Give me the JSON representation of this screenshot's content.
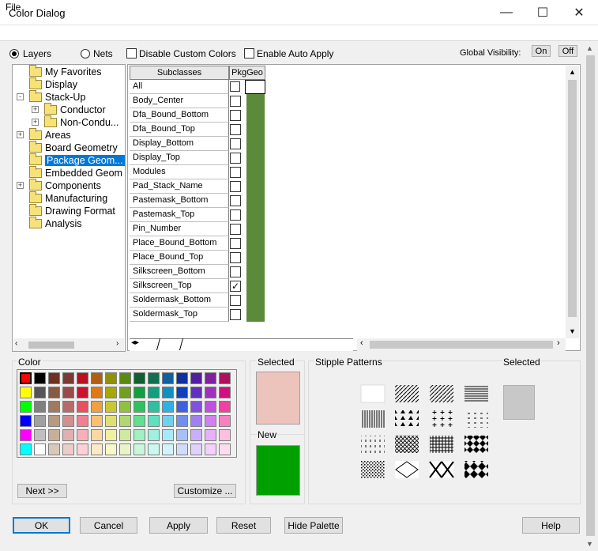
{
  "window": {
    "title": "Color Dialog",
    "minimize": "—",
    "maximize": "☐",
    "close": "✕"
  },
  "menu": {
    "file": "File"
  },
  "toolbar": {
    "layers": "Layers",
    "nets": "Nets",
    "disable_custom": "Disable Custom Colors",
    "enable_auto": "Enable Auto Apply",
    "global_visibility": "Global Visibility:",
    "on": "On",
    "off": "Off"
  },
  "tree": [
    {
      "label": "My Favorites",
      "indent": 0,
      "expander": ""
    },
    {
      "label": "Display",
      "indent": 0,
      "expander": ""
    },
    {
      "label": "Stack-Up",
      "indent": 0,
      "expander": "-"
    },
    {
      "label": "Conductor",
      "indent": 1,
      "expander": "+"
    },
    {
      "label": "Non-Condu...",
      "indent": 1,
      "expander": "+"
    },
    {
      "label": "Areas",
      "indent": 0,
      "expander": "+"
    },
    {
      "label": "Board Geometry",
      "indent": 0,
      "expander": ""
    },
    {
      "label": "Package Geom...",
      "indent": 0,
      "expander": "",
      "selected": true
    },
    {
      "label": "Embedded Geom",
      "indent": 0,
      "expander": ""
    },
    {
      "label": "Components",
      "indent": 0,
      "expander": "+"
    },
    {
      "label": "Manufacturing",
      "indent": 0,
      "expander": ""
    },
    {
      "label": "Drawing Format",
      "indent": 0,
      "expander": ""
    },
    {
      "label": "Analysis",
      "indent": 0,
      "expander": ""
    }
  ],
  "table": {
    "header_subclasses": "Subclasses",
    "header_col": "PkgGeo",
    "all_label": "All",
    "swatch_color": "#5b8a3a",
    "rows": [
      {
        "name": "Body_Center",
        "checked": false
      },
      {
        "name": "Dfa_Bound_Bottom",
        "checked": false
      },
      {
        "name": "Dfa_Bound_Top",
        "checked": false
      },
      {
        "name": "Display_Bottom",
        "checked": false
      },
      {
        "name": "Display_Top",
        "checked": false
      },
      {
        "name": "Modules",
        "checked": false
      },
      {
        "name": "Pad_Stack_Name",
        "checked": false
      },
      {
        "name": "Pastemask_Bottom",
        "checked": false
      },
      {
        "name": "Pastemask_Top",
        "checked": false
      },
      {
        "name": "Pin_Number",
        "checked": false
      },
      {
        "name": "Place_Bound_Bottom",
        "checked": false
      },
      {
        "name": "Place_Bound_Top",
        "checked": false
      },
      {
        "name": "Silkscreen_Bottom",
        "checked": false
      },
      {
        "name": "Silkscreen_Top",
        "checked": true
      },
      {
        "name": "Soldermask_Bottom",
        "checked": false
      },
      {
        "name": "Soldermask_Top",
        "checked": false
      }
    ]
  },
  "color_panel": {
    "label": "Color",
    "next": "Next >>",
    "customize": "Customize ...",
    "palette": [
      [
        "#ff0000",
        "#000000",
        "#703020",
        "#7a3a34",
        "#bb1020",
        "#b06010",
        "#909000",
        "#5a8a10",
        "#106030",
        "#107050",
        "#1060a0",
        "#1030a0",
        "#5020a0",
        "#8020a0",
        "#b01060"
      ],
      [
        "#ffff00",
        "#555555",
        "#8a5a40",
        "#9a4a48",
        "#d01030",
        "#e07a10",
        "#a8a800",
        "#70a020",
        "#10a040",
        "#10a080",
        "#1090c0",
        "#1040c0",
        "#6030c0",
        "#a030c0",
        "#d01080"
      ],
      [
        "#00ff00",
        "#808080",
        "#a07a60",
        "#b86a68",
        "#e85060",
        "#f0a040",
        "#c8c830",
        "#90c040",
        "#30c060",
        "#30c0a0",
        "#30b0e0",
        "#4060e0",
        "#8050e0",
        "#c050e0",
        "#f040a0"
      ],
      [
        "#0000ff",
        "#a0a0a0",
        "#b89a80",
        "#d09090",
        "#f08090",
        "#f8c070",
        "#e0e070",
        "#b0d870",
        "#60e090",
        "#60e0c0",
        "#70d0f0",
        "#7090f0",
        "#a080f0",
        "#d080f0",
        "#f880c0"
      ],
      [
        "#ff00ff",
        "#c0c0c0",
        "#c8b098",
        "#e0b0b0",
        "#f8b0b8",
        "#fad8a0",
        "#f0f0a0",
        "#d0e8a0",
        "#a0f0c0",
        "#a0f0e0",
        "#a8e8f8",
        "#a8c0f8",
        "#c8b0f8",
        "#e8b0f8",
        "#fcc0e0"
      ],
      [
        "#00ffff",
        "#ffffff",
        "#d8c8b8",
        "#ecccc8",
        "#fcd0d4",
        "#fde8c8",
        "#f8f8c8",
        "#e8f4c8",
        "#c8f8dc",
        "#c8f8f0",
        "#d0f4fc",
        "#d0dcfc",
        "#e0d0fc",
        "#f4d0fc",
        "#fedcf0"
      ]
    ]
  },
  "selected_panel": {
    "label": "Selected",
    "selected_color": "#ecc4bc",
    "new_label": "New",
    "new_color": "#00a000"
  },
  "stipple": {
    "label": "Stipple Patterns",
    "selected_label": "Selected",
    "selected_color": "#c8c8c8"
  },
  "buttons": {
    "ok": "OK",
    "cancel": "Cancel",
    "apply": "Apply",
    "reset": "Reset",
    "hide_palette": "Hide Palette",
    "help": "Help"
  }
}
